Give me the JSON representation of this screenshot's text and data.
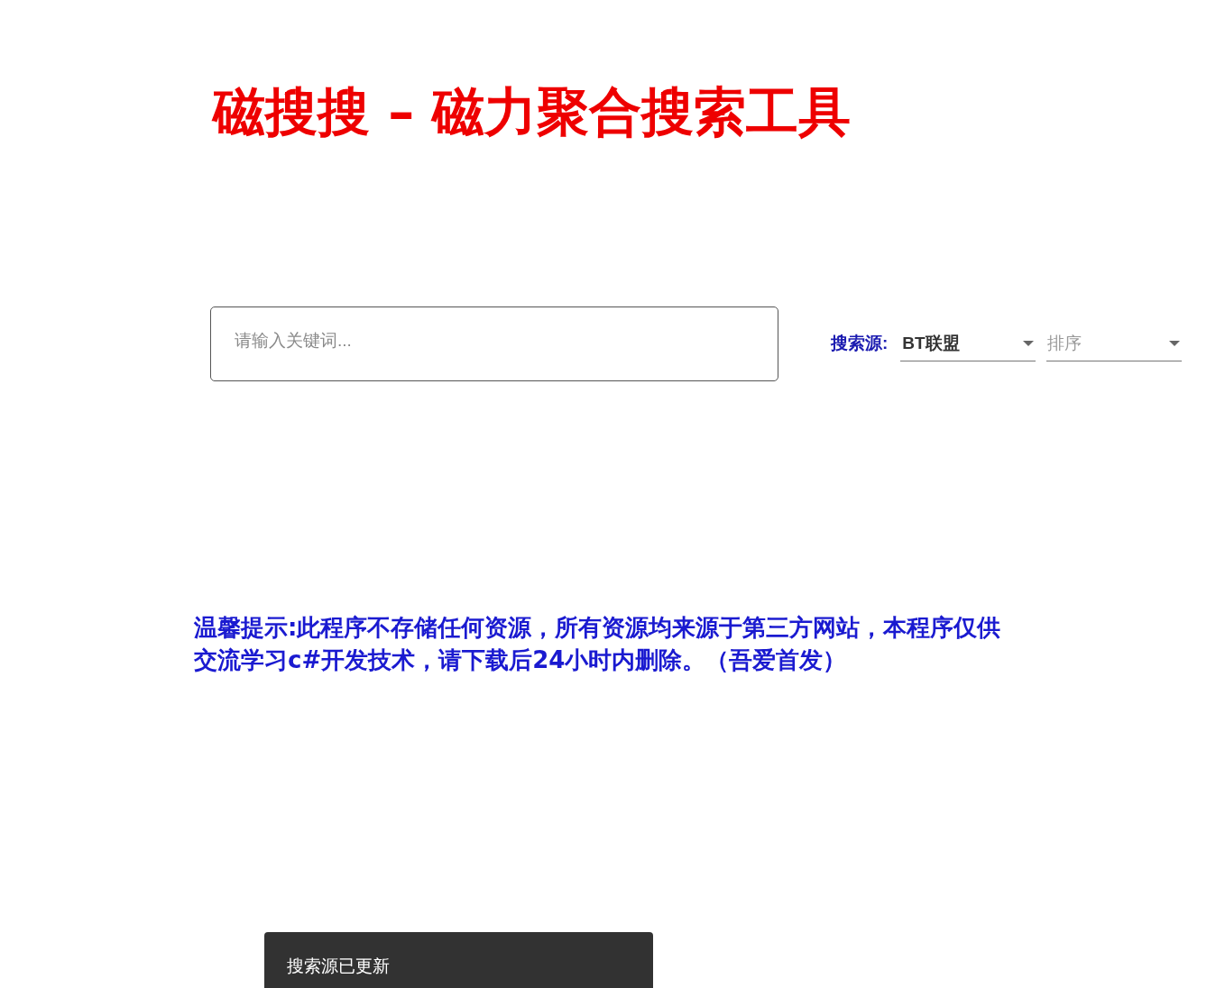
{
  "title": "磁搜搜 – 磁力聚合搜索工具",
  "search": {
    "placeholder": "请输入关键词..."
  },
  "source": {
    "label": "搜索源:",
    "value": "BT联盟"
  },
  "sort": {
    "placeholder": "排序"
  },
  "notice": "温馨提示:此程序不存储任何资源，所有资源均来源于第三方网站，本程序仅供交流学习c#开发技术，请下载后24小时内删除。（吾爱首发）",
  "snackbar": {
    "message": "搜索源已更新"
  }
}
